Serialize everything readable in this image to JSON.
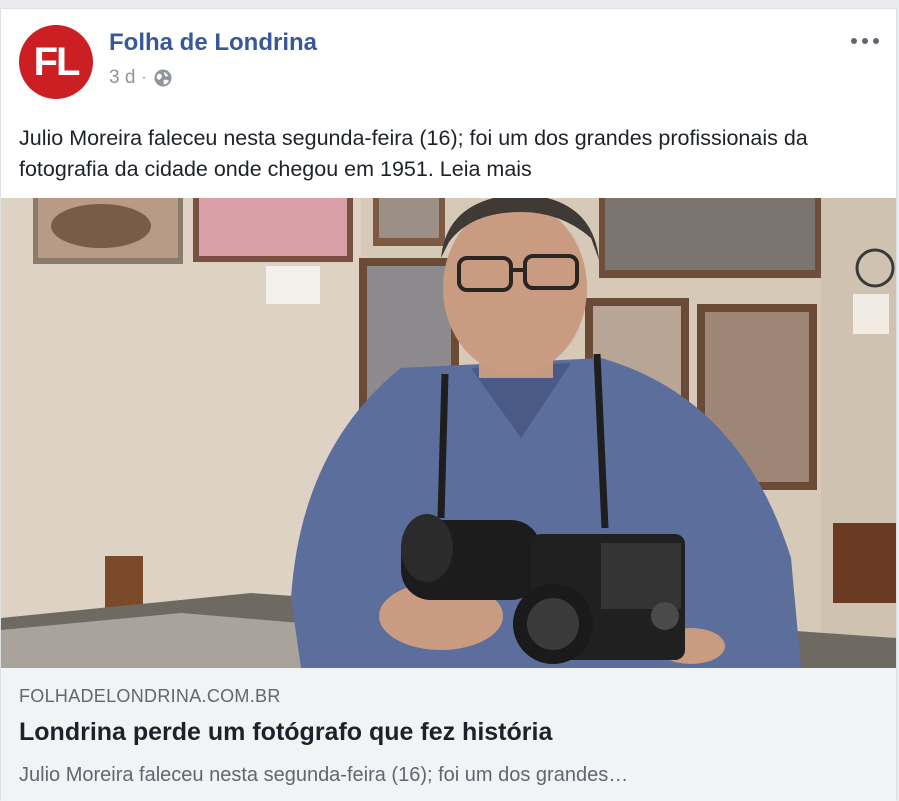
{
  "post": {
    "author": "Folha de Londrina",
    "avatar_initials": "FL",
    "timestamp": "3 d",
    "separator": "·",
    "privacy_icon": "globe-icon",
    "more_icon": "more-options-icon",
    "text": "Julio Moreira faleceu nesta segunda-feira (16); foi um dos grandes profissionais da fotografia da cidade onde chegou em 1951.",
    "read_more": "Leia mais"
  },
  "link_preview": {
    "domain": "FOLHADELONDRINA.COM.BR",
    "title": "Londrina perde um fotógrafo que fez história",
    "description": "Julio Moreira faleceu nesta segunda-feira (16); foi um dos grandes…"
  },
  "colors": {
    "brand_red": "#cc1f24",
    "author_blue": "#385898",
    "preview_bg": "#f2f3f5"
  }
}
